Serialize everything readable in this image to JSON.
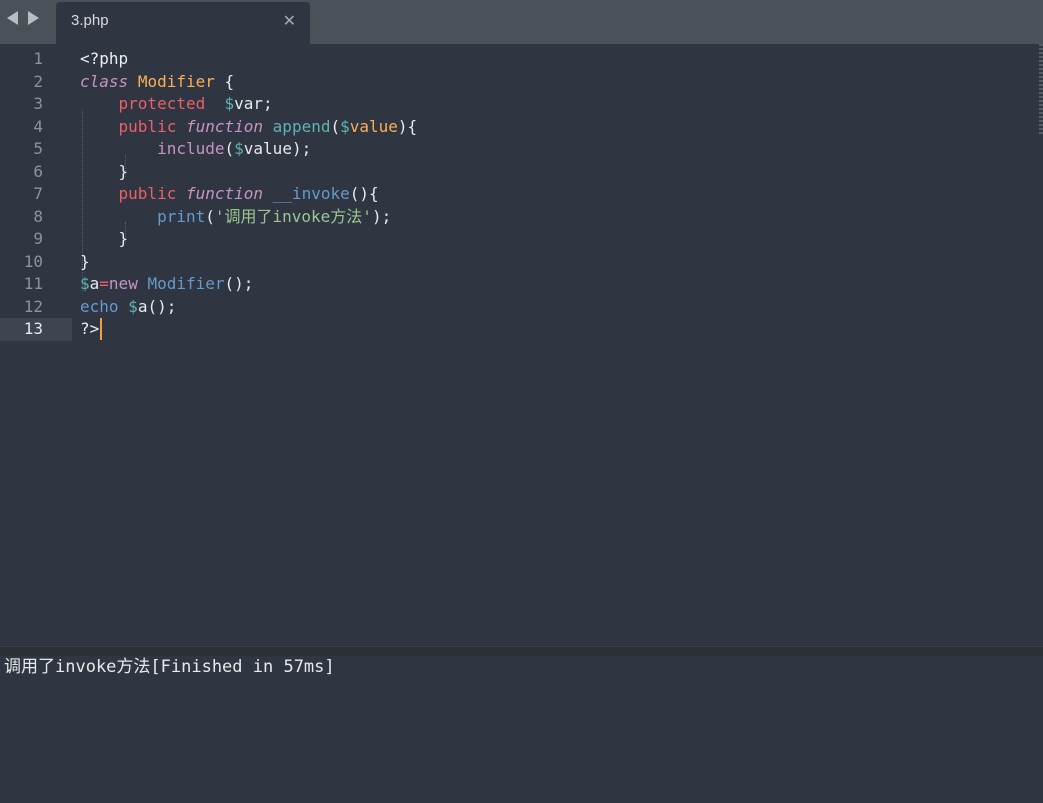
{
  "window": {
    "nav_back": "back",
    "nav_forward": "forward"
  },
  "tab": {
    "title": "3.php",
    "close_icon": "close-icon"
  },
  "editor": {
    "active_line": 13,
    "lines": [
      {
        "num": "1",
        "tokens": [
          {
            "c": "k-tag",
            "t": "<?php"
          }
        ]
      },
      {
        "num": "2",
        "tokens": [
          {
            "c": "k-keyword",
            "t": "class"
          },
          {
            "c": "k-punct",
            "t": " "
          },
          {
            "c": "k-class",
            "t": "Modifier"
          },
          {
            "c": "k-punct",
            "t": " {"
          }
        ]
      },
      {
        "num": "3",
        "tokens": [
          {
            "c": "k-punct",
            "t": "    "
          },
          {
            "c": "k-mod",
            "t": "protected"
          },
          {
            "c": "k-punct",
            "t": "  "
          },
          {
            "c": "k-var",
            "t": "$"
          },
          {
            "c": "k-name",
            "t": "var"
          },
          {
            "c": "k-punct",
            "t": ";"
          }
        ]
      },
      {
        "num": "4",
        "tokens": [
          {
            "c": "k-punct",
            "t": "    "
          },
          {
            "c": "k-mod",
            "t": "public"
          },
          {
            "c": "k-punct",
            "t": " "
          },
          {
            "c": "k-keyword",
            "t": "function"
          },
          {
            "c": "k-punct",
            "t": " "
          },
          {
            "c": "k-fnname",
            "t": "append"
          },
          {
            "c": "k-punct",
            "t": "("
          },
          {
            "c": "k-var",
            "t": "$"
          },
          {
            "c": "k-param",
            "t": "value"
          },
          {
            "c": "k-punct",
            "t": "){"
          }
        ]
      },
      {
        "num": "5",
        "tokens": [
          {
            "c": "k-punct",
            "t": "        "
          },
          {
            "c": "k-inc",
            "t": "include"
          },
          {
            "c": "k-punct",
            "t": "("
          },
          {
            "c": "k-var",
            "t": "$"
          },
          {
            "c": "k-name",
            "t": "value"
          },
          {
            "c": "k-punct",
            "t": ");"
          }
        ]
      },
      {
        "num": "6",
        "tokens": [
          {
            "c": "k-punct",
            "t": "    }"
          }
        ]
      },
      {
        "num": "7",
        "tokens": [
          {
            "c": "k-punct",
            "t": "    "
          },
          {
            "c": "k-mod",
            "t": "public"
          },
          {
            "c": "k-punct",
            "t": " "
          },
          {
            "c": "k-keyword",
            "t": "function"
          },
          {
            "c": "k-punct",
            "t": " "
          },
          {
            "c": "k-fn",
            "t": "__invoke"
          },
          {
            "c": "k-punct",
            "t": "(){"
          }
        ]
      },
      {
        "num": "8",
        "tokens": [
          {
            "c": "k-punct",
            "t": "        "
          },
          {
            "c": "k-fn",
            "t": "print"
          },
          {
            "c": "k-punct",
            "t": "("
          },
          {
            "c": "k-str",
            "t": "'调用了invoke方法'"
          },
          {
            "c": "k-punct",
            "t": ");"
          }
        ]
      },
      {
        "num": "9",
        "tokens": [
          {
            "c": "k-punct",
            "t": "    }"
          }
        ]
      },
      {
        "num": "10",
        "tokens": [
          {
            "c": "k-punct",
            "t": "}"
          }
        ]
      },
      {
        "num": "11",
        "tokens": [
          {
            "c": "k-var",
            "t": "$"
          },
          {
            "c": "k-name",
            "t": "a"
          },
          {
            "c": "k-mod",
            "t": "="
          },
          {
            "c": "k-inc",
            "t": "new"
          },
          {
            "c": "k-punct",
            "t": " "
          },
          {
            "c": "k-fn",
            "t": "Modifier"
          },
          {
            "c": "k-punct",
            "t": "();"
          }
        ]
      },
      {
        "num": "12",
        "tokens": [
          {
            "c": "k-fn",
            "t": "echo"
          },
          {
            "c": "k-punct",
            "t": " "
          },
          {
            "c": "k-var",
            "t": "$"
          },
          {
            "c": "k-name",
            "t": "a"
          },
          {
            "c": "k-punct",
            "t": "();"
          }
        ]
      },
      {
        "num": "13",
        "tokens": [
          {
            "c": "k-tag",
            "t": "?>"
          }
        ]
      }
    ]
  },
  "output": {
    "text": "调用了invoke方法[Finished in 57ms]"
  },
  "colors": {
    "background": "#303641",
    "tabbar": "#4b5159",
    "caret": "#f0a040"
  }
}
